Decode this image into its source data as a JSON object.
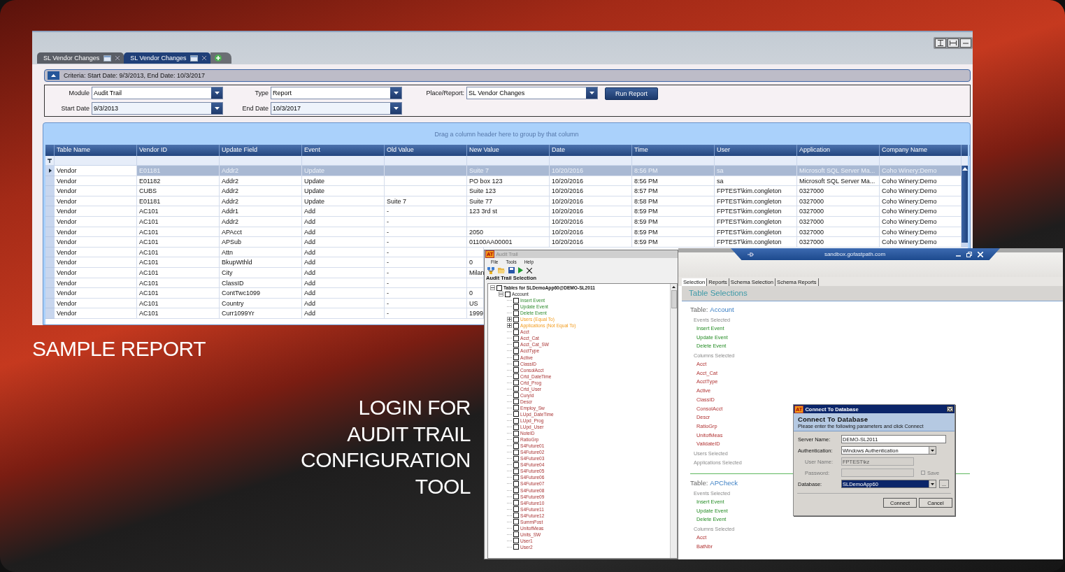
{
  "report": {
    "tabs": [
      {
        "label": "SL Vendor Changes",
        "selected": false
      },
      {
        "label": "SL Vendor Changes",
        "selected": true
      }
    ],
    "criteria": "Criteria: Start Date: 9/3/2013, End Date: 10/3/2017",
    "filters": [
      {
        "label": "Module",
        "value": "Audit Trail"
      },
      {
        "label": "Type",
        "value": "Report"
      },
      {
        "label": "Place/Report:",
        "value": "SL Vendor Changes"
      },
      {
        "label": "Start Date",
        "value": "9/3/2013"
      },
      {
        "label": "End Date",
        "value": "10/3/2017"
      }
    ],
    "run_button": "Run Report",
    "group_hint": "Drag a column header here to group by that column",
    "columns": [
      "Table Name",
      "Vendor ID",
      "Update Field",
      "Event",
      "Old Value",
      "New Value",
      "Date",
      "Time",
      "User",
      "Application",
      "Company Name"
    ],
    "rows": [
      {
        "selected": true,
        "table_name": "Vendor",
        "vendor_id": "E01181",
        "update_field": "Addr2",
        "event": "Update",
        "new_value": "Suite 7",
        "date": "10/20/2016",
        "time": "8:56 PM",
        "user": "sa",
        "application": "Microsoft SQL Server Ma...",
        "company_name": "Coho Winery:Demo"
      },
      {
        "selected": false,
        "table_name": "Vendor",
        "vendor_id": "E01182",
        "update_field": "Addr2",
        "event": "Update",
        "new_value": "PO box 123",
        "date": "10/20/2016",
        "time": "8:56 PM",
        "user": "sa",
        "application": "Microsoft SQL Server Ma...",
        "company_name": "Coho Winery:Demo"
      },
      {
        "selected": false,
        "table_name": "Vendor",
        "vendor_id": "CUBS",
        "update_field": "Addr2",
        "event": "Update",
        "new_value": "Suite 123",
        "date": "10/20/2016",
        "time": "8:57 PM",
        "user": "FPTEST\\kim.congleton",
        "application": "0327000",
        "company_name": "Coho Winery:Demo"
      },
      {
        "selected": false,
        "table_name": "Vendor",
        "vendor_id": "E01181",
        "update_field": "Addr2",
        "event": "Update",
        "old_value": "Suite 7",
        "new_value": "Suite 77",
        "date": "10/20/2016",
        "time": "8:58 PM",
        "user": "FPTEST\\kim.congleton",
        "application": "0327000",
        "company_name": "Coho Winery:Demo"
      },
      {
        "selected": false,
        "table_name": "Vendor",
        "vendor_id": "AC101",
        "update_field": "Addr1",
        "event": "Add",
        "old_value": "-",
        "new_value": "123 3rd st",
        "date": "10/20/2016",
        "time": "8:59 PM",
        "user": "FPTEST\\kim.congleton",
        "application": "0327000",
        "company_name": "Coho Winery:Demo"
      },
      {
        "selected": false,
        "table_name": "Vendor",
        "vendor_id": "AC101",
        "update_field": "Addr2",
        "event": "Add",
        "old_value": "-",
        "date": "10/20/2016",
        "time": "8:59 PM",
        "user": "FPTEST\\kim.congleton",
        "application": "0327000",
        "company_name": "Coho Winery:Demo"
      },
      {
        "selected": false,
        "table_name": "Vendor",
        "vendor_id": "AC101",
        "update_field": "APAcct",
        "event": "Add",
        "old_value": "-",
        "new_value": "2050",
        "date": "10/20/2016",
        "time": "8:59 PM",
        "user": "FPTEST\\kim.congleton",
        "application": "0327000",
        "company_name": "Coho Winery:Demo"
      },
      {
        "selected": false,
        "table_name": "Vendor",
        "vendor_id": "AC101",
        "update_field": "APSub",
        "event": "Add",
        "old_value": "-",
        "new_value": "01100AA00001",
        "date": "10/20/2016",
        "time": "8:59 PM",
        "user": "FPTEST\\kim.congleton",
        "application": "0327000",
        "company_name": "Coho Winery:Demo"
      },
      {
        "selected": false,
        "table_name": "Vendor",
        "vendor_id": "AC101",
        "update_field": "Attn",
        "event": "Add",
        "old_value": "-"
      },
      {
        "selected": false,
        "table_name": "Vendor",
        "vendor_id": "AC101",
        "update_field": "BkupWthld",
        "event": "Add",
        "old_value": "-",
        "new_value": "0"
      },
      {
        "selected": false,
        "table_name": "Vendor",
        "vendor_id": "AC101",
        "update_field": "City",
        "event": "Add",
        "old_value": "-",
        "new_value": "Milan"
      },
      {
        "selected": false,
        "table_name": "Vendor",
        "vendor_id": "AC101",
        "update_field": "ClassID",
        "event": "Add",
        "old_value": "-"
      },
      {
        "selected": false,
        "table_name": "Vendor",
        "vendor_id": "AC101",
        "update_field": "ContTwc1099",
        "event": "Add",
        "old_value": "-",
        "new_value": "0"
      },
      {
        "selected": false,
        "table_name": "Vendor",
        "vendor_id": "AC101",
        "update_field": "Country",
        "event": "Add",
        "old_value": "-",
        "new_value": "US"
      },
      {
        "selected": false,
        "table_name": "Vendor",
        "vendor_id": "AC101",
        "update_field": "Curr1099Yr",
        "event": "Add",
        "old_value": "-",
        "new_value": "1999"
      }
    ]
  },
  "captions": {
    "sample": "SAMPLE REPORT",
    "login": [
      "LOGIN FOR",
      "AUDIT TRAIL",
      "CONFIGURATION",
      "TOOL"
    ]
  },
  "audit_window": {
    "badge": "AT",
    "title": "Audit Trail",
    "menu": [
      "File",
      "Tools",
      "Help"
    ],
    "section": "Audit Trail Selection",
    "tree": [
      {
        "label": "Tables for SLDemoApp60@DEMO-SL2011",
        "kind": "root",
        "checked": false,
        "expanded": true,
        "children": [
          {
            "label": "Account",
            "kind": "table",
            "checked": false,
            "expanded": true,
            "children": [
              {
                "label": "Insert Event",
                "kind": "event",
                "checked": false
              },
              {
                "label": "Update Event",
                "kind": "event",
                "checked": false
              },
              {
                "label": "Delete Event",
                "kind": "event",
                "checked": false
              },
              {
                "label": "Users (Equal To)",
                "kind": "filter",
                "checked": false,
                "expanded": false
              },
              {
                "label": "Applications (Not Equal To)",
                "kind": "filter",
                "checked": false,
                "expanded": false
              },
              {
                "label": "Acct",
                "kind": "column",
                "checked": false
              },
              {
                "label": "Acct_Cat",
                "kind": "column",
                "checked": false
              },
              {
                "label": "Acct_Cat_SW",
                "kind": "column",
                "checked": false
              },
              {
                "label": "AcctType",
                "kind": "column",
                "checked": false
              },
              {
                "label": "Active",
                "kind": "column",
                "checked": false
              },
              {
                "label": "ClassID",
                "kind": "column",
                "checked": false
              },
              {
                "label": "ConsolAcct",
                "kind": "column",
                "checked": false
              },
              {
                "label": "Crtd_DateTime",
                "kind": "column",
                "checked": false
              },
              {
                "label": "Crtd_Prog",
                "kind": "column",
                "checked": false
              },
              {
                "label": "Crtd_User",
                "kind": "column",
                "checked": false
              },
              {
                "label": "CuryId",
                "kind": "column",
                "checked": false
              },
              {
                "label": "Descr",
                "kind": "column",
                "checked": false
              },
              {
                "label": "Employ_Sw",
                "kind": "column",
                "checked": false
              },
              {
                "label": "LUpd_DateTime",
                "kind": "column",
                "checked": false
              },
              {
                "label": "LUpd_Prog",
                "kind": "column",
                "checked": false
              },
              {
                "label": "LUpd_User",
                "kind": "column",
                "checked": false
              },
              {
                "label": "NoteID",
                "kind": "column",
                "checked": false
              },
              {
                "label": "RatioGrp",
                "kind": "column",
                "checked": false
              },
              {
                "label": "S4Future01",
                "kind": "column",
                "checked": false
              },
              {
                "label": "S4Future02",
                "kind": "column",
                "checked": false
              },
              {
                "label": "S4Future03",
                "kind": "column",
                "checked": false
              },
              {
                "label": "S4Future04",
                "kind": "column",
                "checked": false
              },
              {
                "label": "S4Future05",
                "kind": "column",
                "checked": false
              },
              {
                "label": "S4Future06",
                "kind": "column",
                "checked": false
              },
              {
                "label": "S4Future07",
                "kind": "column",
                "checked": false
              },
              {
                "label": "S4Future08",
                "kind": "column",
                "checked": false
              },
              {
                "label": "S4Future09",
                "kind": "column",
                "checked": false
              },
              {
                "label": "S4Future10",
                "kind": "column",
                "checked": false
              },
              {
                "label": "S4Future11",
                "kind": "column",
                "checked": false
              },
              {
                "label": "S4Future12",
                "kind": "column",
                "checked": false
              },
              {
                "label": "SummPost",
                "kind": "column",
                "checked": false
              },
              {
                "label": "UnitofMeas",
                "kind": "column",
                "checked": false
              },
              {
                "label": "Units_SW",
                "kind": "column",
                "checked": false
              },
              {
                "label": "User1",
                "kind": "column",
                "checked": false
              },
              {
                "label": "User2",
                "kind": "column",
                "checked": false
              }
            ]
          }
        ]
      }
    ]
  },
  "remote_window": {
    "title": "sandbox.gofastpath.com",
    "tabs": [
      {
        "label": "Selection",
        "selected": true
      },
      {
        "label": "Reports",
        "selected": false
      },
      {
        "label": "Schema Selection",
        "selected": false
      },
      {
        "label": "Schema Reports",
        "selected": false
      }
    ],
    "heading": "Table Selections",
    "tables": [
      {
        "label": "Table:",
        "name": "Account",
        "groups": [
          {
            "label": "Events Selected",
            "kind": "event",
            "items": [
              "Insert Event",
              "Update Event",
              "Delete Event"
            ]
          },
          {
            "label": "Columns Selected",
            "kind": "column",
            "items": [
              "Acct",
              "Acct_Cat",
              "AcctType",
              "Active",
              "ClassID",
              "ConsolAcct",
              "Descr",
              "RatioGrp",
              "UnitofMeas",
              "ValidateID"
            ]
          },
          {
            "label": "Users Selected"
          },
          {
            "label": "Applications Selected"
          }
        ]
      },
      {
        "label": "Table:",
        "name": "APCheck",
        "groups": [
          {
            "label": "Events Selected",
            "kind": "event",
            "items": [
              "Insert Event",
              "Update Event",
              "Delete Event"
            ]
          },
          {
            "label": "Columns Selected",
            "kind": "column",
            "items": [
              "Acct",
              "BatNbr"
            ]
          }
        ]
      }
    ]
  },
  "dialog": {
    "badge": "AT",
    "title": "Connect To Database",
    "heading": "Connect To Database",
    "subtitle": "Please enter the following parameters and click Connect",
    "fields": [
      {
        "label": "Server Name:",
        "value": "DEMO-SL2011",
        "kind": "text",
        "disabled": false,
        "focused": false
      },
      {
        "label": "Authentication:",
        "value": "Windows Authentication",
        "kind": "dropdown",
        "disabled": false,
        "focused": false
      },
      {
        "label": "User Name:",
        "value": "FPTEST\\kz",
        "kind": "text",
        "disabled": true,
        "focused": false
      },
      {
        "label": "Password:",
        "kind": "password",
        "disabled": true,
        "focused": false
      },
      {
        "label": "Database:",
        "value": "SLDemoApp60",
        "kind": "dropdown",
        "disabled": false,
        "focused": true
      }
    ],
    "save": {
      "label": "Save",
      "checked": false,
      "disabled": true
    },
    "browse": "...",
    "buttons": [
      "Connect",
      "Cancel"
    ]
  }
}
